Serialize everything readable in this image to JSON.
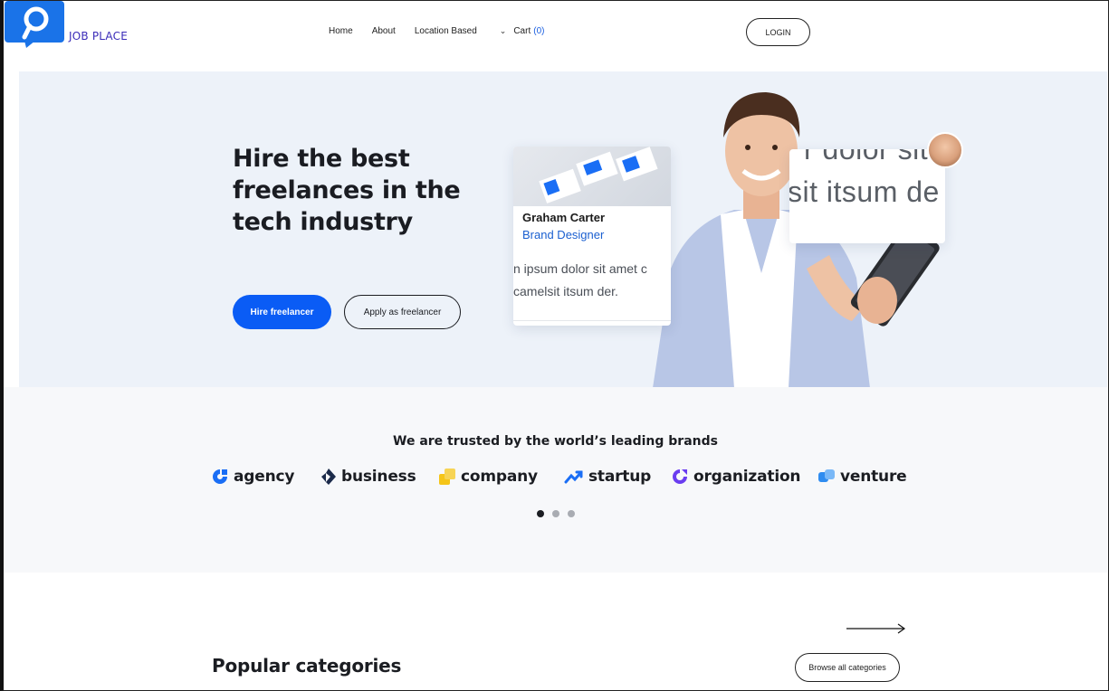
{
  "header": {
    "logo_text": "JOB PLACE",
    "nav": [
      "Home",
      "About",
      "Location Based"
    ],
    "cart_label": "Cart",
    "cart_count": "(0)",
    "login_label": "LOGIN"
  },
  "hero": {
    "title": "Hire the best freelances in the tech industry",
    "primary_button": "Hire freelancer",
    "secondary_button": "Apply as freelancer",
    "card": {
      "name": "Graham Carter",
      "role": "Brand Designer",
      "text_line1": "n ipsum dolor sit amet c",
      "text_line2": "camelsit itsum der."
    },
    "card2": {
      "text_top": "r dolor sit",
      "text_main": "sit itsum de"
    }
  },
  "brands": {
    "title": "We are trusted by the world’s leading brands",
    "items": [
      {
        "label": "agency",
        "icon": "agency-logo-icon",
        "color": "#1a6ef5"
      },
      {
        "label": "business",
        "icon": "business-logo-icon",
        "color": "#1b2a4a"
      },
      {
        "label": "company",
        "icon": "company-logo-icon",
        "color": "#f5c518"
      },
      {
        "label": "startup",
        "icon": "startup-logo-icon",
        "color": "#1a6ef5"
      },
      {
        "label": "organization",
        "icon": "organization-logo-icon",
        "color": "#6a3df0"
      },
      {
        "label": "venture",
        "icon": "venture-logo-icon",
        "color": "#2f8cf0"
      }
    ],
    "carousel_pages": 3,
    "carousel_active": 1
  },
  "categories": {
    "title": "Popular categories",
    "browse_label": "Browse all categories"
  },
  "colors": {
    "accent": "#0a5cf5",
    "hero_bg": "#edf2f9",
    "logo_blue": "#1a73e8",
    "logo_text": "#3a2bb8"
  }
}
